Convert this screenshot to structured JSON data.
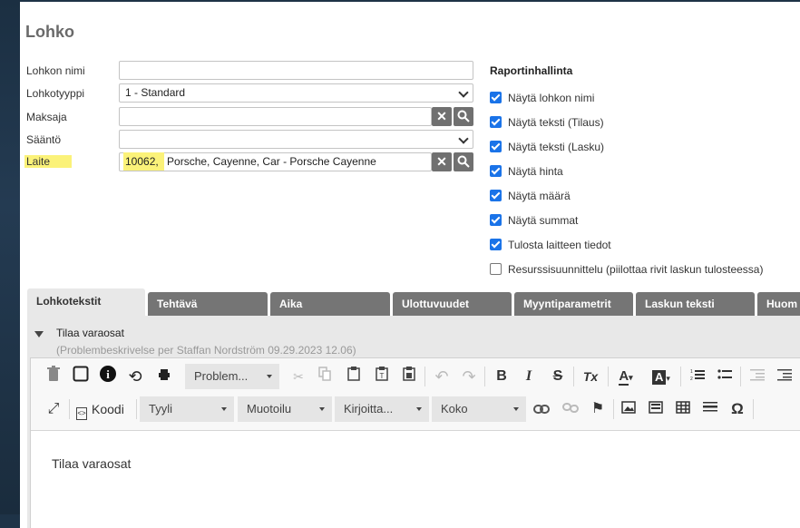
{
  "dialog": {
    "title": "Lohko"
  },
  "form": {
    "name_label": "Lohkon nimi",
    "name_value": "",
    "type_label": "Lohkotyyppi",
    "type_value": "1 - Standard",
    "payer_label": "Maksaja",
    "payer_value": "",
    "rule_label": "Sääntö",
    "rule_value": "",
    "device_label": "Laite",
    "device_value_hl": "10062,",
    "device_value_rest": " Porsche, Cayenne, Car - Porsche Cayenne"
  },
  "report": {
    "title": "Raportinhallinta",
    "items": [
      {
        "label": "Näytä lohkon nimi",
        "checked": true
      },
      {
        "label": "Näytä teksti (Tilaus)",
        "checked": true
      },
      {
        "label": "Näytä teksti (Lasku)",
        "checked": true
      },
      {
        "label": "Näytä hinta",
        "checked": true
      },
      {
        "label": "Näytä määrä",
        "checked": true
      },
      {
        "label": "Näytä summat",
        "checked": true
      },
      {
        "label": "Tulosta laitteen tiedot",
        "checked": true
      },
      {
        "label": "Resurssisuunnittelu (piilottaa rivit laskun tulosteessa)",
        "checked": false
      }
    ]
  },
  "tabs": [
    "Lohkotekstit",
    "Tehtävä",
    "Aika",
    "Ulottuvuudet",
    "Myyntiparametrit",
    "Laskun teksti",
    "Huom"
  ],
  "panel": {
    "title": "Tilaa varaosat",
    "subtitle": "(Problembeskrivelse per Staffan Nordström 09.29.2023 12.06)"
  },
  "editor": {
    "template_dropdown": "Problem...",
    "source_label": "Koodi",
    "style_dropdown": "Tyyli",
    "format_dropdown": "Muotoilu",
    "font_dropdown": "Kirjoitta...",
    "size_dropdown": "Koko",
    "content": "Tilaa varaosat"
  },
  "icons": {
    "trash": "🗑",
    "info": "i",
    "history": "⟲",
    "print": "🖶",
    "cut": "✂",
    "bold": "B",
    "italic": "I",
    "strike": "S",
    "clear": "Tx",
    "omega": "Ω",
    "flag": "⚑",
    "link": "🔗",
    "search": "⌕",
    "clear_x": "✕"
  },
  "colors": {
    "checkbox": "#1a73e8",
    "tab": "#757575",
    "highlight": "#fbf279"
  }
}
